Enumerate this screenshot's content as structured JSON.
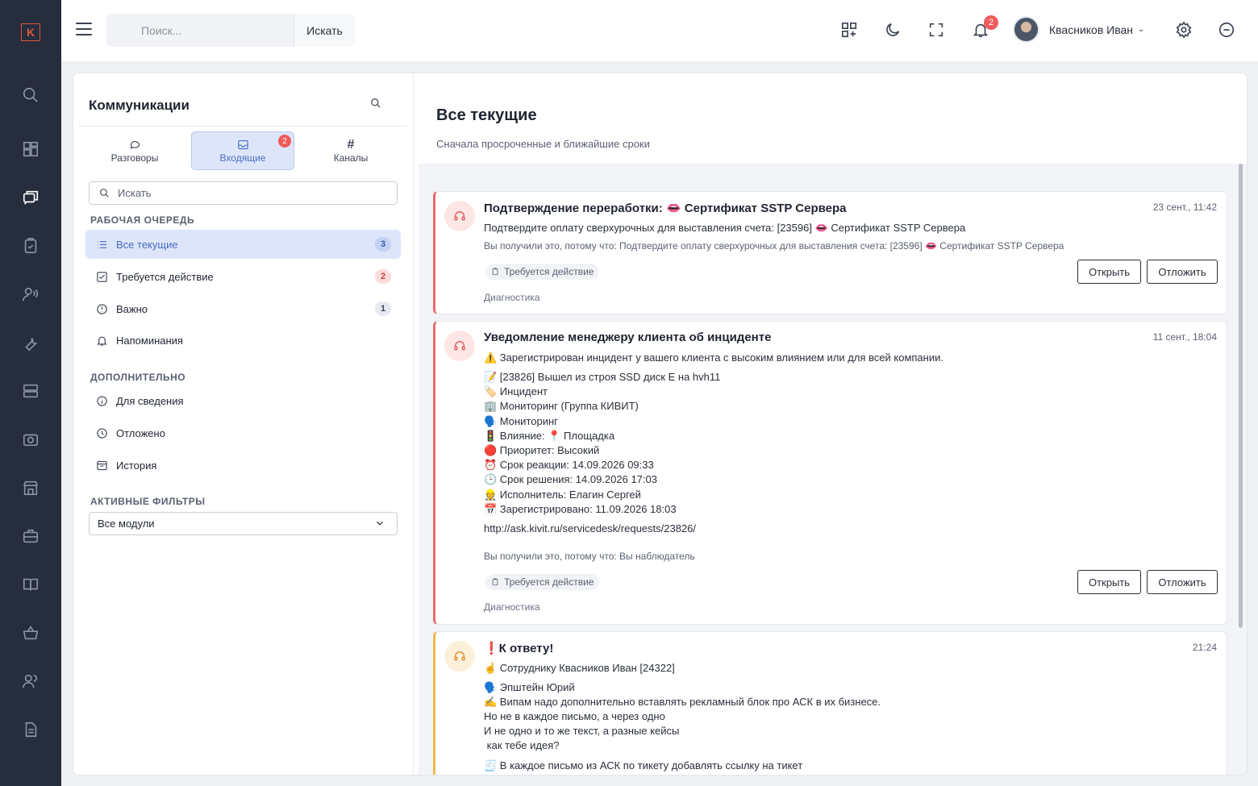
{
  "topbar": {
    "search_placeholder": "Поиск...",
    "search_button": "Искать",
    "notifications_count": "2",
    "user_name": "Квасников Иван"
  },
  "sidebar": {
    "title": "Коммуникации",
    "tabs": [
      {
        "label": "Разговоры"
      },
      {
        "label": "Входящие",
        "badge": "2"
      },
      {
        "label": "Каналы"
      }
    ],
    "filter_placeholder": "Искать",
    "section_queue": "РАБОЧАЯ ОЧЕРЕДЬ",
    "queue": [
      {
        "label": "Все текущие",
        "count": "3"
      },
      {
        "label": "Требуется действие",
        "count": "2"
      },
      {
        "label": "Важно",
        "count": "1"
      },
      {
        "label": "Напоминания"
      }
    ],
    "section_extra": "ДОПОЛНИТЕЛЬНО",
    "extra": [
      {
        "label": "Для сведения"
      },
      {
        "label": "Отложено"
      },
      {
        "label": "История"
      }
    ],
    "section_filters": "АКТИВНЫЕ ФИЛЬТРЫ",
    "module_select": "Все модули"
  },
  "content": {
    "title": "Все текущие",
    "subtitle": "Сначала просроченные и ближайшие сроки",
    "cards": [
      {
        "title": "Подтверждение переработки: 👄 Сертификат SSTP Сервера",
        "time": "23 сент., 11:42",
        "body": "Подтвердите оплату сверхурочных для выставления счета: [23596] 👄 Сертификат SSTP Сервера",
        "reason": "Вы получили это, потому что: Подтвердите оплату сверхурочных для выставления счета: [23596] 👄 Сертификат SSTP Сервера",
        "tag": "Требуется действие",
        "open": "Открыть",
        "postpone": "Отложить",
        "category": "Диагностика"
      },
      {
        "title": "Уведомление менеджеру клиента об инциденте",
        "time": "11 сент., 18:04",
        "lines": [
          "⚠️ Зарегистрирован инцидент у вашего клиента с высоким влиянием или для всей компании.",
          "📝 [23826] Вышел из строя SSD диск E на hvh11",
          "🏷️ Инцидент",
          "🏢 Мониторинг (Группа КИВИТ)",
          "🗣️ Мониторинг",
          "🚦 Влияние: 📍 Площадка",
          "🔴 Приоритет: Высокий",
          "⏰ Срок реакции: 14.09.2026 09:33",
          "🕒 Срок решения: 14.09.2026 17:03",
          "👷 Исполнитель: Елагин Сергей",
          "📅 Зарегистрировано: 11.09.2026 18:03",
          "http://ask.kivit.ru/servicedesk/requests/23826/"
        ],
        "reason": "Вы получили это, потому что: Вы наблюдатель",
        "tag": "Требуется действие",
        "open": "Открыть",
        "postpone": "Отложить",
        "category": "Диагностика"
      },
      {
        "title": "❗К ответу!",
        "time": "21:24",
        "lines": [
          "☝️ Сотруднику Квасников Иван [24322]",
          "🗣️ Эпштейн Юрий",
          "✍️ Випам надо дополнительно вставлять рекламный блок про АСК в их бизнесе.",
          "Но не в каждое письмо, а через одно",
          "И не одно и то же текст, а разные кейсы",
          " как тебе идея?",
          "🧾 В каждое письмо из АСК по тикету добавлять ссылку на тикет"
        ]
      }
    ]
  }
}
